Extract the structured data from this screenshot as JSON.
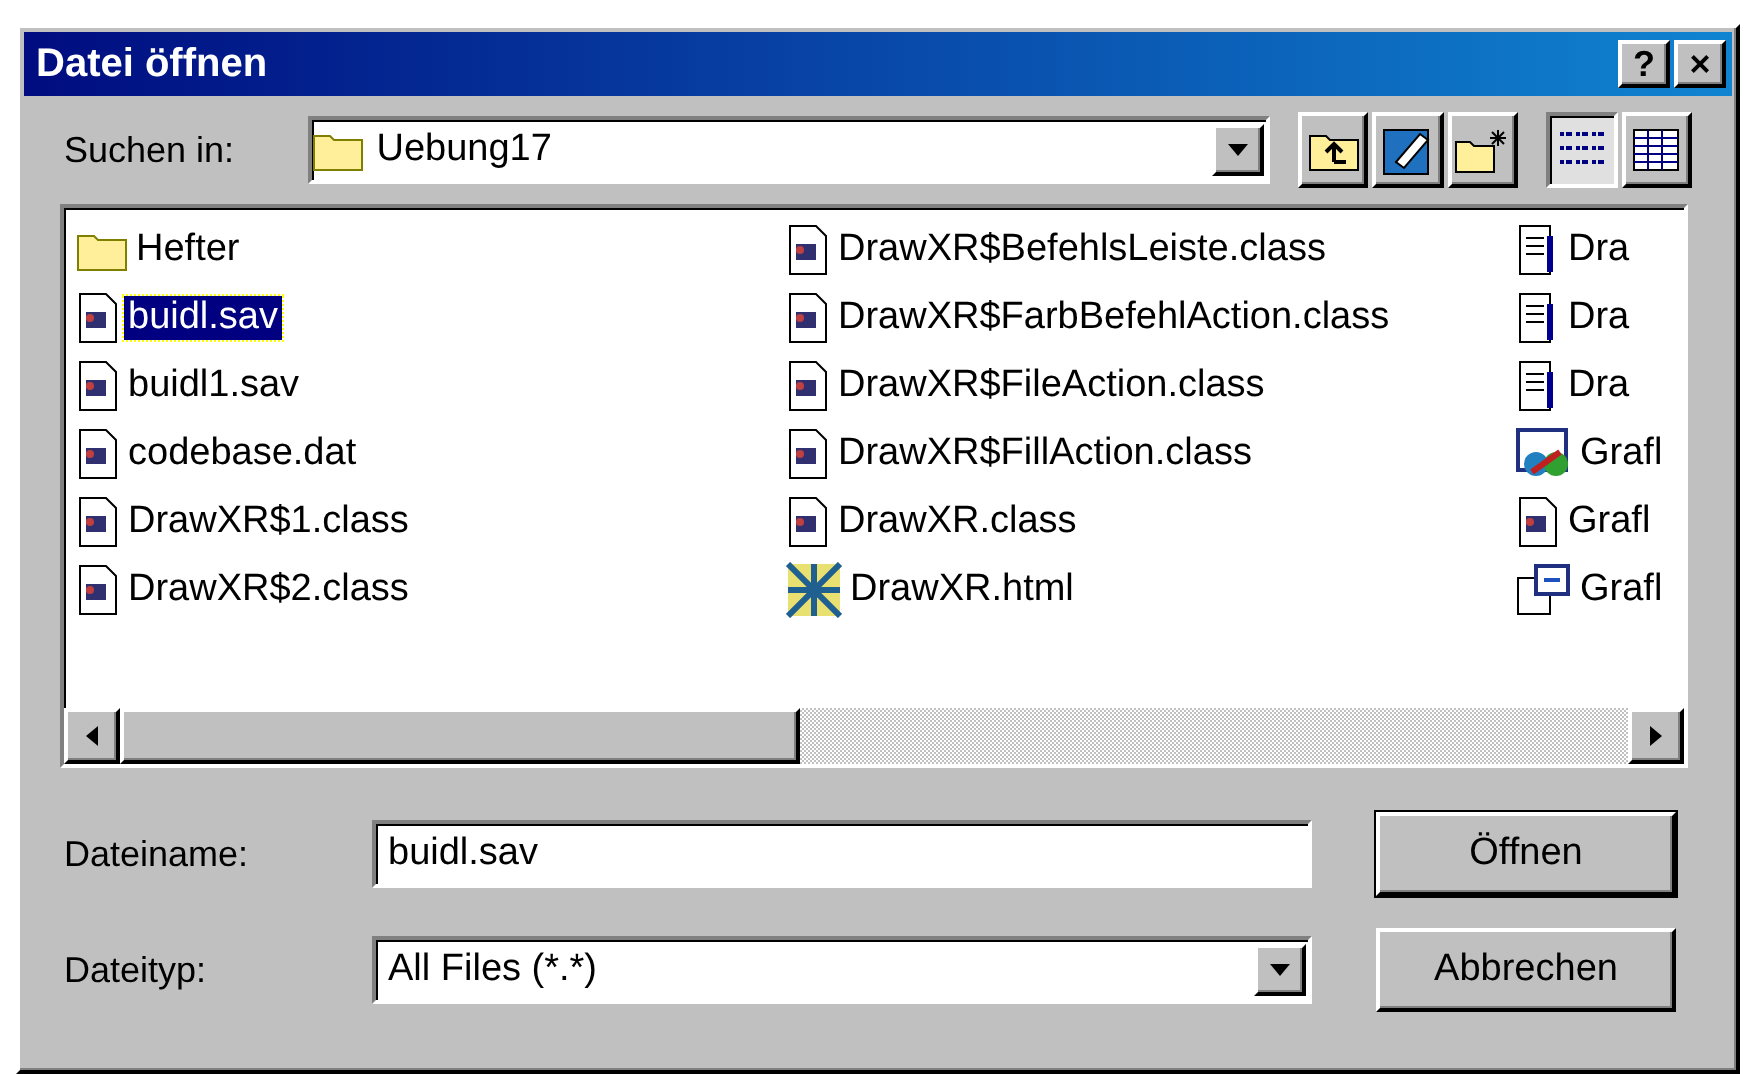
{
  "window": {
    "title": "Datei öffnen",
    "title_buttons": [
      "?",
      "×"
    ]
  },
  "look_in": {
    "label": "Suchen in:",
    "value": "Uebung17"
  },
  "toolbar": [
    {
      "kind": "up",
      "selected": false
    },
    {
      "kind": "desktop",
      "selected": false
    },
    {
      "kind": "newfolder",
      "selected": false
    },
    {
      "kind": "list",
      "selected": true
    },
    {
      "kind": "details",
      "selected": false
    }
  ],
  "file_columns": [
    [
      {
        "name": "Hefter",
        "kind": "folder",
        "selected": false
      },
      {
        "name": "buidl.sav",
        "kind": "java",
        "selected": true
      },
      {
        "name": "buidl1.sav",
        "kind": "java",
        "selected": false
      },
      {
        "name": "codebase.dat",
        "kind": "java",
        "selected": false
      },
      {
        "name": "DrawXR$1.class",
        "kind": "java",
        "selected": false
      },
      {
        "name": "DrawXR$2.class",
        "kind": "java",
        "selected": false
      }
    ],
    [
      {
        "name": "DrawXR$BefehlsLeiste.class",
        "kind": "java",
        "selected": false
      },
      {
        "name": "DrawXR$FarbBefehlAction.class",
        "kind": "java",
        "selected": false
      },
      {
        "name": "DrawXR$FileAction.class",
        "kind": "java",
        "selected": false
      },
      {
        "name": "DrawXR$FillAction.class",
        "kind": "java",
        "selected": false
      },
      {
        "name": "DrawXR.class",
        "kind": "java",
        "selected": false
      },
      {
        "name": "DrawXR.html",
        "kind": "html",
        "selected": false
      }
    ],
    [
      {
        "name": "Dra",
        "kind": "text",
        "selected": false
      },
      {
        "name": "Dra",
        "kind": "text",
        "selected": false
      },
      {
        "name": "Dra",
        "kind": "text",
        "selected": false
      },
      {
        "name": "Grafl",
        "kind": "project",
        "selected": false
      },
      {
        "name": "Grafl",
        "kind": "java",
        "selected": false
      },
      {
        "name": "Grafl",
        "kind": "doc",
        "selected": false
      }
    ]
  ],
  "file_name": {
    "label": "Dateiname:",
    "value": "buidl.sav"
  },
  "file_type": {
    "label": "Dateityp:",
    "value": "All Files (*.*)"
  },
  "buttons": [
    "Öffnen",
    "Abbrechen"
  ]
}
